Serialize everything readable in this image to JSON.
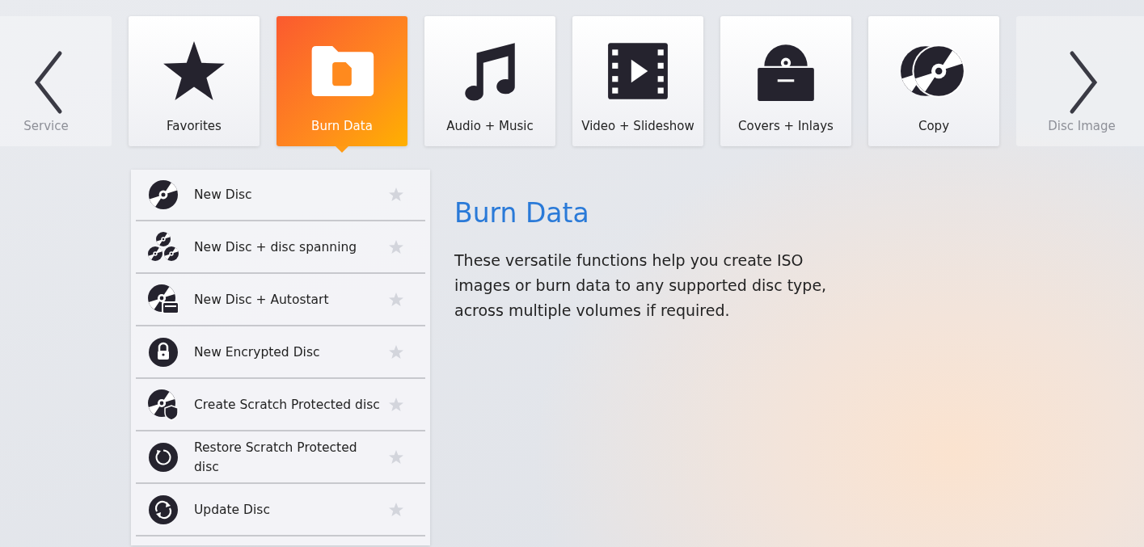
{
  "categories": [
    {
      "label": "Service",
      "kind": "blank",
      "selected": false,
      "dimmed": true
    },
    {
      "label": "Favorites",
      "kind": "star",
      "selected": false,
      "dimmed": false
    },
    {
      "label": "Burn Data",
      "kind": "folder",
      "selected": true,
      "dimmed": false
    },
    {
      "label": "Audio + Music",
      "kind": "music",
      "selected": false,
      "dimmed": false
    },
    {
      "label": "Video + Slideshow",
      "kind": "film",
      "selected": false,
      "dimmed": false
    },
    {
      "label": "Covers + Inlays",
      "kind": "cover",
      "selected": false,
      "dimmed": false
    },
    {
      "label": "Copy",
      "kind": "copy",
      "selected": false,
      "dimmed": false
    },
    {
      "label": "Disc Image",
      "kind": "blank",
      "selected": false,
      "dimmed": true
    }
  ],
  "functions": [
    {
      "label": "New Disc",
      "kind": "disc",
      "favorite": false
    },
    {
      "label": "New Disc + disc spanning",
      "kind": "discs",
      "favorite": false
    },
    {
      "label": "New Disc + Autostart",
      "kind": "autostart",
      "favorite": false
    },
    {
      "label": "New Encrypted Disc",
      "kind": "lock",
      "favorite": false
    },
    {
      "label": "Create Scratch Protected disc",
      "kind": "shield",
      "favorite": false
    },
    {
      "label": "Restore Scratch Protected disc",
      "kind": "restore",
      "favorite": false
    },
    {
      "label": "Update Disc",
      "kind": "update",
      "favorite": false
    }
  ],
  "detail": {
    "title": "Burn Data",
    "description": "These versatile functions help you create ISO images or burn data to any supported disc type, across multiple volumes if required."
  }
}
